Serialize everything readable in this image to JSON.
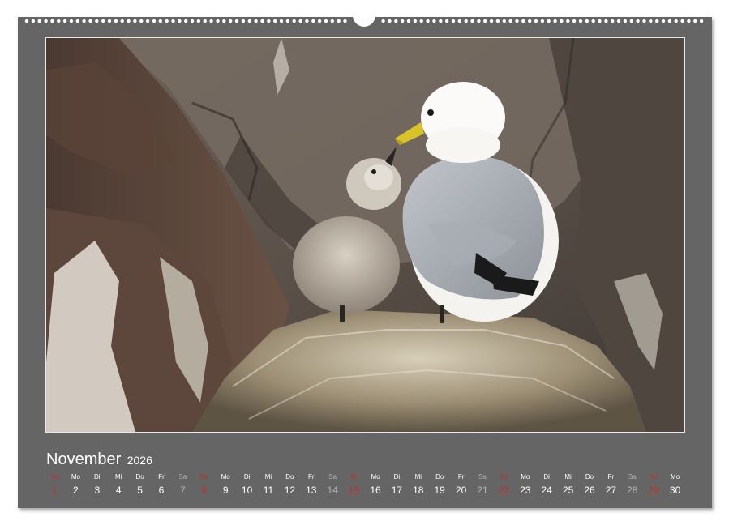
{
  "calendar": {
    "month": "November",
    "year": "2026",
    "weekdays": [
      "So",
      "Mo",
      "Di",
      "Mi",
      "Do",
      "Fr",
      "Sa",
      "So",
      "Mo",
      "Di",
      "Mi",
      "Do",
      "Fr",
      "Sa",
      "So",
      "Mo",
      "Di",
      "Mi",
      "Do",
      "Fr",
      "Sa",
      "So",
      "Mo",
      "Di",
      "Mi",
      "Do",
      "Fr",
      "Sa",
      "So",
      "Mo"
    ],
    "dates": [
      "1",
      "2",
      "3",
      "4",
      "5",
      "6",
      "7",
      "8",
      "9",
      "10",
      "11",
      "12",
      "13",
      "14",
      "15",
      "16",
      "17",
      "18",
      "19",
      "20",
      "21",
      "22",
      "23",
      "24",
      "25",
      "26",
      "27",
      "28",
      "29",
      "30"
    ]
  },
  "colors": {
    "sheet_background": "#656565",
    "weekday_text": "#ffffff",
    "saturday_text": "#b3b3b3",
    "sunday_text": "#c0302c"
  },
  "photo": {
    "subject": "kittiwake-adult-and-chick-on-nest"
  }
}
